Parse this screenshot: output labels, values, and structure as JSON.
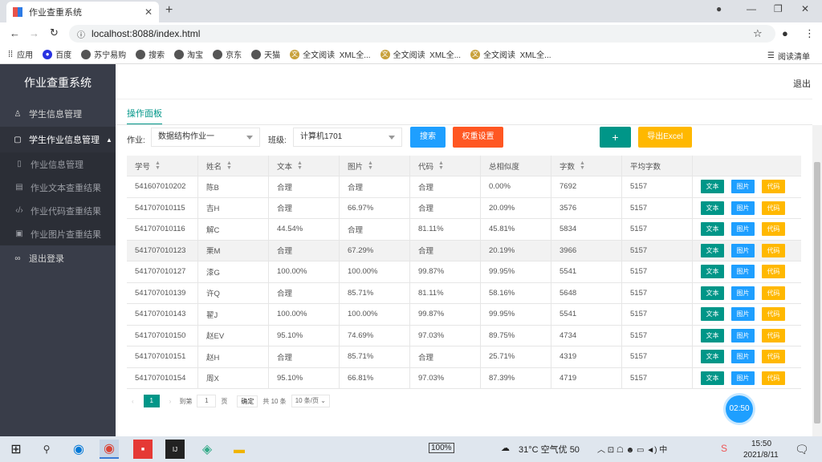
{
  "browser": {
    "tab_title": "作业查重系统",
    "url": "localhost:8088/index.html",
    "bookmarks": [
      "应用",
      "百度",
      "苏宁易购",
      "搜索",
      "淘宝",
      "京东",
      "天猫",
      "全文阅读",
      "XML全...",
      "全文阅读",
      "XML全...",
      "全文阅读",
      "XML全..."
    ],
    "reading_list": "阅读清单"
  },
  "sidebar": {
    "title": "作业查重系统",
    "items": [
      {
        "label": "学生信息管理",
        "icon": "user-icon"
      },
      {
        "label": "学生作业信息管理",
        "icon": "document-icon"
      }
    ],
    "subitems": [
      {
        "label": "作业信息管理",
        "icon": "file-icon"
      },
      {
        "label": "作业文本查重结果",
        "icon": "text-file-icon"
      },
      {
        "label": "作业代码查重结果",
        "icon": "code-icon"
      },
      {
        "label": "作业图片查重结果",
        "icon": "image-icon"
      }
    ],
    "logout": {
      "label": "退出登录",
      "icon": "link-icon"
    }
  },
  "header": {
    "logout": "退出"
  },
  "panel": {
    "tab": "操作面板",
    "assignment_label": "作业:",
    "assignment_value": "数据结构作业一",
    "class_label": "班级:",
    "class_value": "计算机1701",
    "search_btn": "搜索",
    "weight_btn": "权重设置",
    "add_btn": "+",
    "export_btn": "导出Excel"
  },
  "table": {
    "headers": [
      "学号",
      "姓名",
      "文本",
      "图片",
      "代码",
      "总相似度",
      "字数",
      "平均字数",
      ""
    ],
    "sortable": [
      true,
      true,
      true,
      true,
      true,
      false,
      true,
      false,
      false
    ],
    "rows": [
      [
        "541607010202",
        "陈B",
        "合理",
        "合理",
        "合理",
        "0.00%",
        "7692",
        "5157"
      ],
      [
        "541707010115",
        "吉H",
        "合理",
        "66.97%",
        "合理",
        "20.09%",
        "3576",
        "5157"
      ],
      [
        "541707010116",
        "解C",
        "44.54%",
        "合理",
        "81.11%",
        "45.81%",
        "5834",
        "5157"
      ],
      [
        "541707010123",
        "栗M",
        "合理",
        "67.29%",
        "合理",
        "20.19%",
        "3966",
        "5157"
      ],
      [
        "541707010127",
        "漆G",
        "100.00%",
        "100.00%",
        "99.87%",
        "99.95%",
        "5541",
        "5157"
      ],
      [
        "541707010139",
        "许Q",
        "合理",
        "85.71%",
        "81.11%",
        "58.16%",
        "5648",
        "5157"
      ],
      [
        "541707010143",
        "翟J",
        "100.00%",
        "100.00%",
        "99.87%",
        "99.95%",
        "5541",
        "5157"
      ],
      [
        "541707010150",
        "赵EV",
        "95.10%",
        "74.69%",
        "97.03%",
        "89.75%",
        "4734",
        "5157"
      ],
      [
        "541707010151",
        "赵H",
        "合理",
        "85.71%",
        "合理",
        "25.71%",
        "4319",
        "5157"
      ],
      [
        "541707010154",
        "周X",
        "95.10%",
        "66.81%",
        "97.03%",
        "87.39%",
        "4719",
        "5157"
      ]
    ],
    "op_text": "文本",
    "op_image": "图片",
    "op_code": "代码",
    "highlight_row": 3
  },
  "pager": {
    "current": "1",
    "goto_label": "到第",
    "goto_value": "1",
    "page_unit": "页",
    "confirm": "确定",
    "total": "共 10 条",
    "per_page": "10 条/页"
  },
  "timer": "02:50",
  "taskbar": {
    "battery": "100%",
    "weather": "31°C 空气优 50",
    "time": "15:50",
    "date": "2021/8/11"
  },
  "colors": {
    "sidebar": "#393d49",
    "teal": "#009688",
    "blue": "#1e9fff",
    "orange": "#ff5722",
    "yellow": "#ffb800"
  }
}
